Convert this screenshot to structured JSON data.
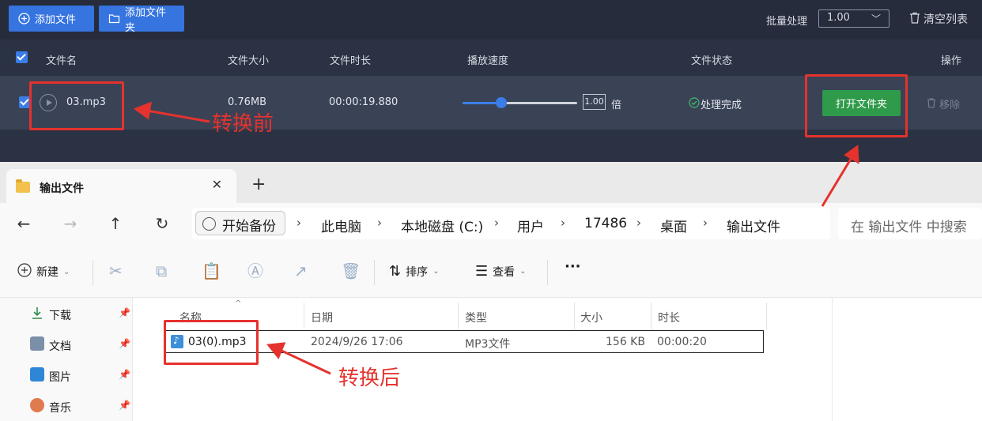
{
  "converter": {
    "toolbar": {
      "add_file_label": "添加文件",
      "add_folder_label": "添加文件夹",
      "batch_label": "批量处理",
      "batch_value": "1.00",
      "clear_list_label": "清空列表"
    },
    "columns": {
      "filename": "文件名",
      "filesize": "文件大小",
      "duration": "文件时长",
      "speed": "播放速度",
      "status": "文件状态",
      "action": "操作"
    },
    "row": {
      "filename": "03.mp3",
      "filesize": "0.76MB",
      "duration": "00:00:19.880",
      "speed_value": "1.00",
      "speed_unit": "倍",
      "speed_fraction": 0.34,
      "status": "处理完成",
      "open_folder_label": "打开文件夹",
      "remove_label": "移除"
    }
  },
  "explorer": {
    "tab_title": "输出文件",
    "breadcrumb": {
      "backup": "开始备份",
      "items": [
        "此电脑",
        "本地磁盘 (C:)",
        "用户",
        "17486",
        "桌面",
        "输出文件"
      ]
    },
    "search_placeholder": "在 输出文件 中搜索",
    "commands": {
      "new": "新建",
      "sort": "排序",
      "view": "查看",
      "more": "···"
    },
    "sidebar": [
      {
        "label": "下载",
        "icon": "download-icon"
      },
      {
        "label": "文档",
        "icon": "document-icon"
      },
      {
        "label": "图片",
        "icon": "picture-icon"
      },
      {
        "label": "音乐",
        "icon": "music-icon"
      }
    ],
    "columns": [
      "名称",
      "日期",
      "类型",
      "大小",
      "时长"
    ],
    "files": [
      {
        "name": "03(0).mp3",
        "date": "2024/9/26 17:06",
        "type": "MP3文件",
        "size": "156 KB",
        "duration": "00:00:20"
      }
    ]
  },
  "annotations": {
    "before": "转换前",
    "after": "转换后",
    "color": "#e5322d"
  }
}
